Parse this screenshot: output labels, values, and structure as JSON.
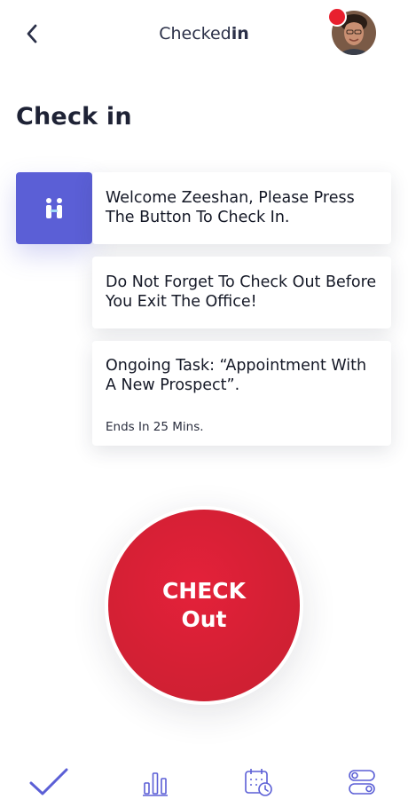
{
  "header": {
    "brand_regular": "Checked",
    "brand_bold": "in"
  },
  "page": {
    "title": "Check in"
  },
  "messages": {
    "welcome": "Welcome Zeeshan, Please Press The Button To Check In.",
    "reminder": "Do Not Forget To Check Out Before You Exit The Office!",
    "task": "Ongoing Task: “Appointment With A New Prospect”.",
    "task_ends": "Ends In 25 Mins."
  },
  "check_button": {
    "line1": "CHECK",
    "line2": "Out"
  },
  "nav": {
    "items": [
      {
        "name": "check",
        "icon": "checkmark-icon",
        "active": true
      },
      {
        "name": "stats",
        "icon": "bar-chart-icon",
        "active": false
      },
      {
        "name": "schedule",
        "icon": "calendar-clock-icon",
        "active": false
      },
      {
        "name": "settings",
        "icon": "toggles-icon",
        "active": false
      }
    ]
  },
  "colors": {
    "accent": "#5b5fd6",
    "danger": "#d42034",
    "text": "#1e2235",
    "nav_icon": "#5b5fd6"
  }
}
